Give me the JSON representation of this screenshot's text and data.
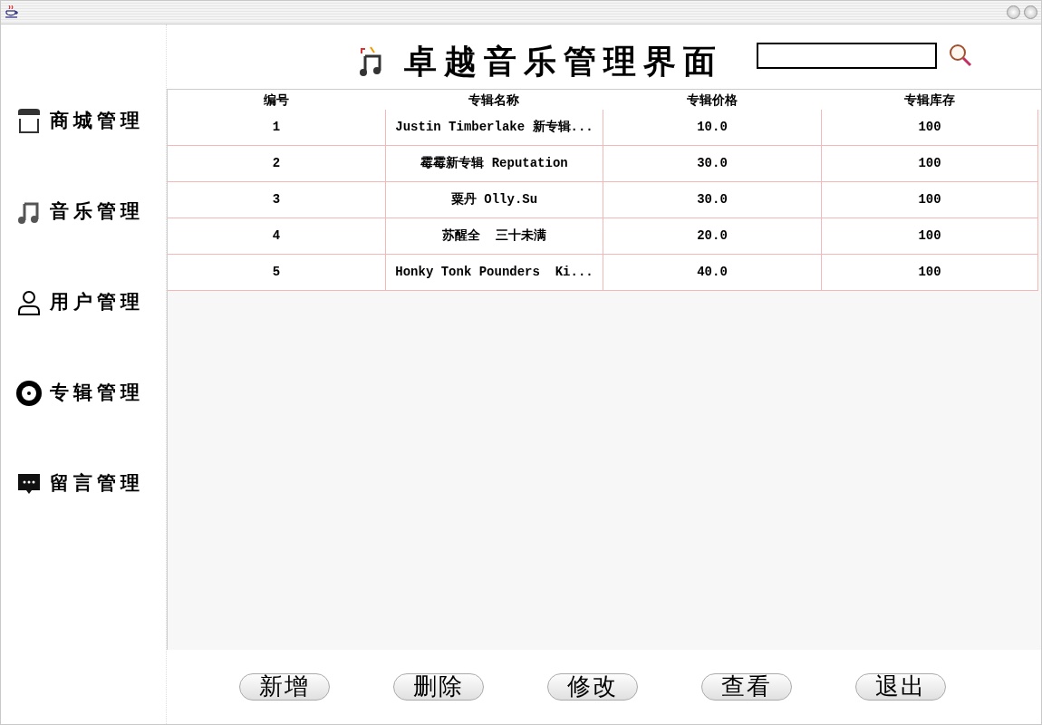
{
  "title": "卓越音乐管理界面",
  "sidebar": {
    "items": [
      {
        "label": "商城管理",
        "kind": "store"
      },
      {
        "label": "音乐管理",
        "kind": "music"
      },
      {
        "label": "用户管理",
        "kind": "user"
      },
      {
        "label": "专辑管理",
        "kind": "disc"
      },
      {
        "label": "留言管理",
        "kind": "message"
      }
    ]
  },
  "table": {
    "columns": [
      "编号",
      "专辑名称",
      "专辑价格",
      "专辑库存"
    ],
    "rows": [
      [
        "1",
        "Justin Timberlake 新专辑...",
        "10.0",
        "100"
      ],
      [
        "2",
        "霉霉新专辑 Reputation",
        "30.0",
        "100"
      ],
      [
        "3",
        "粟丹 Olly.Su",
        "30.0",
        "100"
      ],
      [
        "4",
        "苏醒全  三十未满",
        "20.0",
        "100"
      ],
      [
        "5",
        "Honky Tonk Pounders  Ki...",
        "40.0",
        "100"
      ]
    ]
  },
  "buttons": [
    "新增",
    "删除",
    "修改",
    "查看",
    "退出"
  ]
}
